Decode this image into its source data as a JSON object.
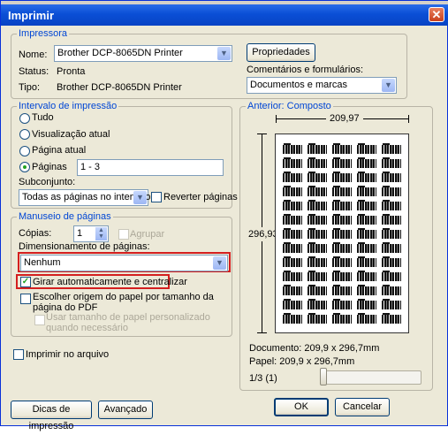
{
  "window": {
    "title": "Imprimir",
    "close_glyph": "✕"
  },
  "printer": {
    "legend": "Impressora",
    "name_label": "Nome:",
    "name_value": "Brother DCP-8065DN Printer",
    "status_label": "Status:",
    "status_value": "Pronta",
    "type_label": "Tipo:",
    "type_value": "Brother DCP-8065DN Printer",
    "properties_button": "Propriedades",
    "comments_label": "Comentários e formulários:",
    "comments_value": "Documentos e marcas"
  },
  "range": {
    "legend": "Intervalo de impressão",
    "all": "Tudo",
    "current_view": "Visualização atual",
    "current_page": "Página atual",
    "pages": "Páginas",
    "pages_value": "1 - 3",
    "subset_label": "Subconjunto:",
    "subset_value": "Todas as páginas no intervalo",
    "reverse": "Reverter páginas"
  },
  "handling": {
    "legend": "Manuseio de páginas",
    "copies_label": "Cópias:",
    "copies_value": "1",
    "collate": "Agrupar",
    "scaling_label": "Dimensionamento de páginas:",
    "scaling_value": "Nenhum",
    "auto_rotate": "Girar automaticamente e centralizar",
    "paper_source": "Escolher origem do papel por tamanho da página do PDF",
    "custom_size": "Usar tamanho de papel personalizado quando necessário"
  },
  "print_to_file": "Imprimir no arquivo",
  "preview": {
    "legend": "Anterior: Composto",
    "width": "209,97",
    "height": "296,93",
    "document": "Documento: 209,9 x 296,7mm",
    "paper": "Papel: 209,9 x 296,7mm",
    "page_counter": "1/3 (1)"
  },
  "buttons": {
    "tips": "Dicas de impressão",
    "advanced": "Avançado",
    "ok": "OK",
    "cancel": "Cancelar"
  }
}
